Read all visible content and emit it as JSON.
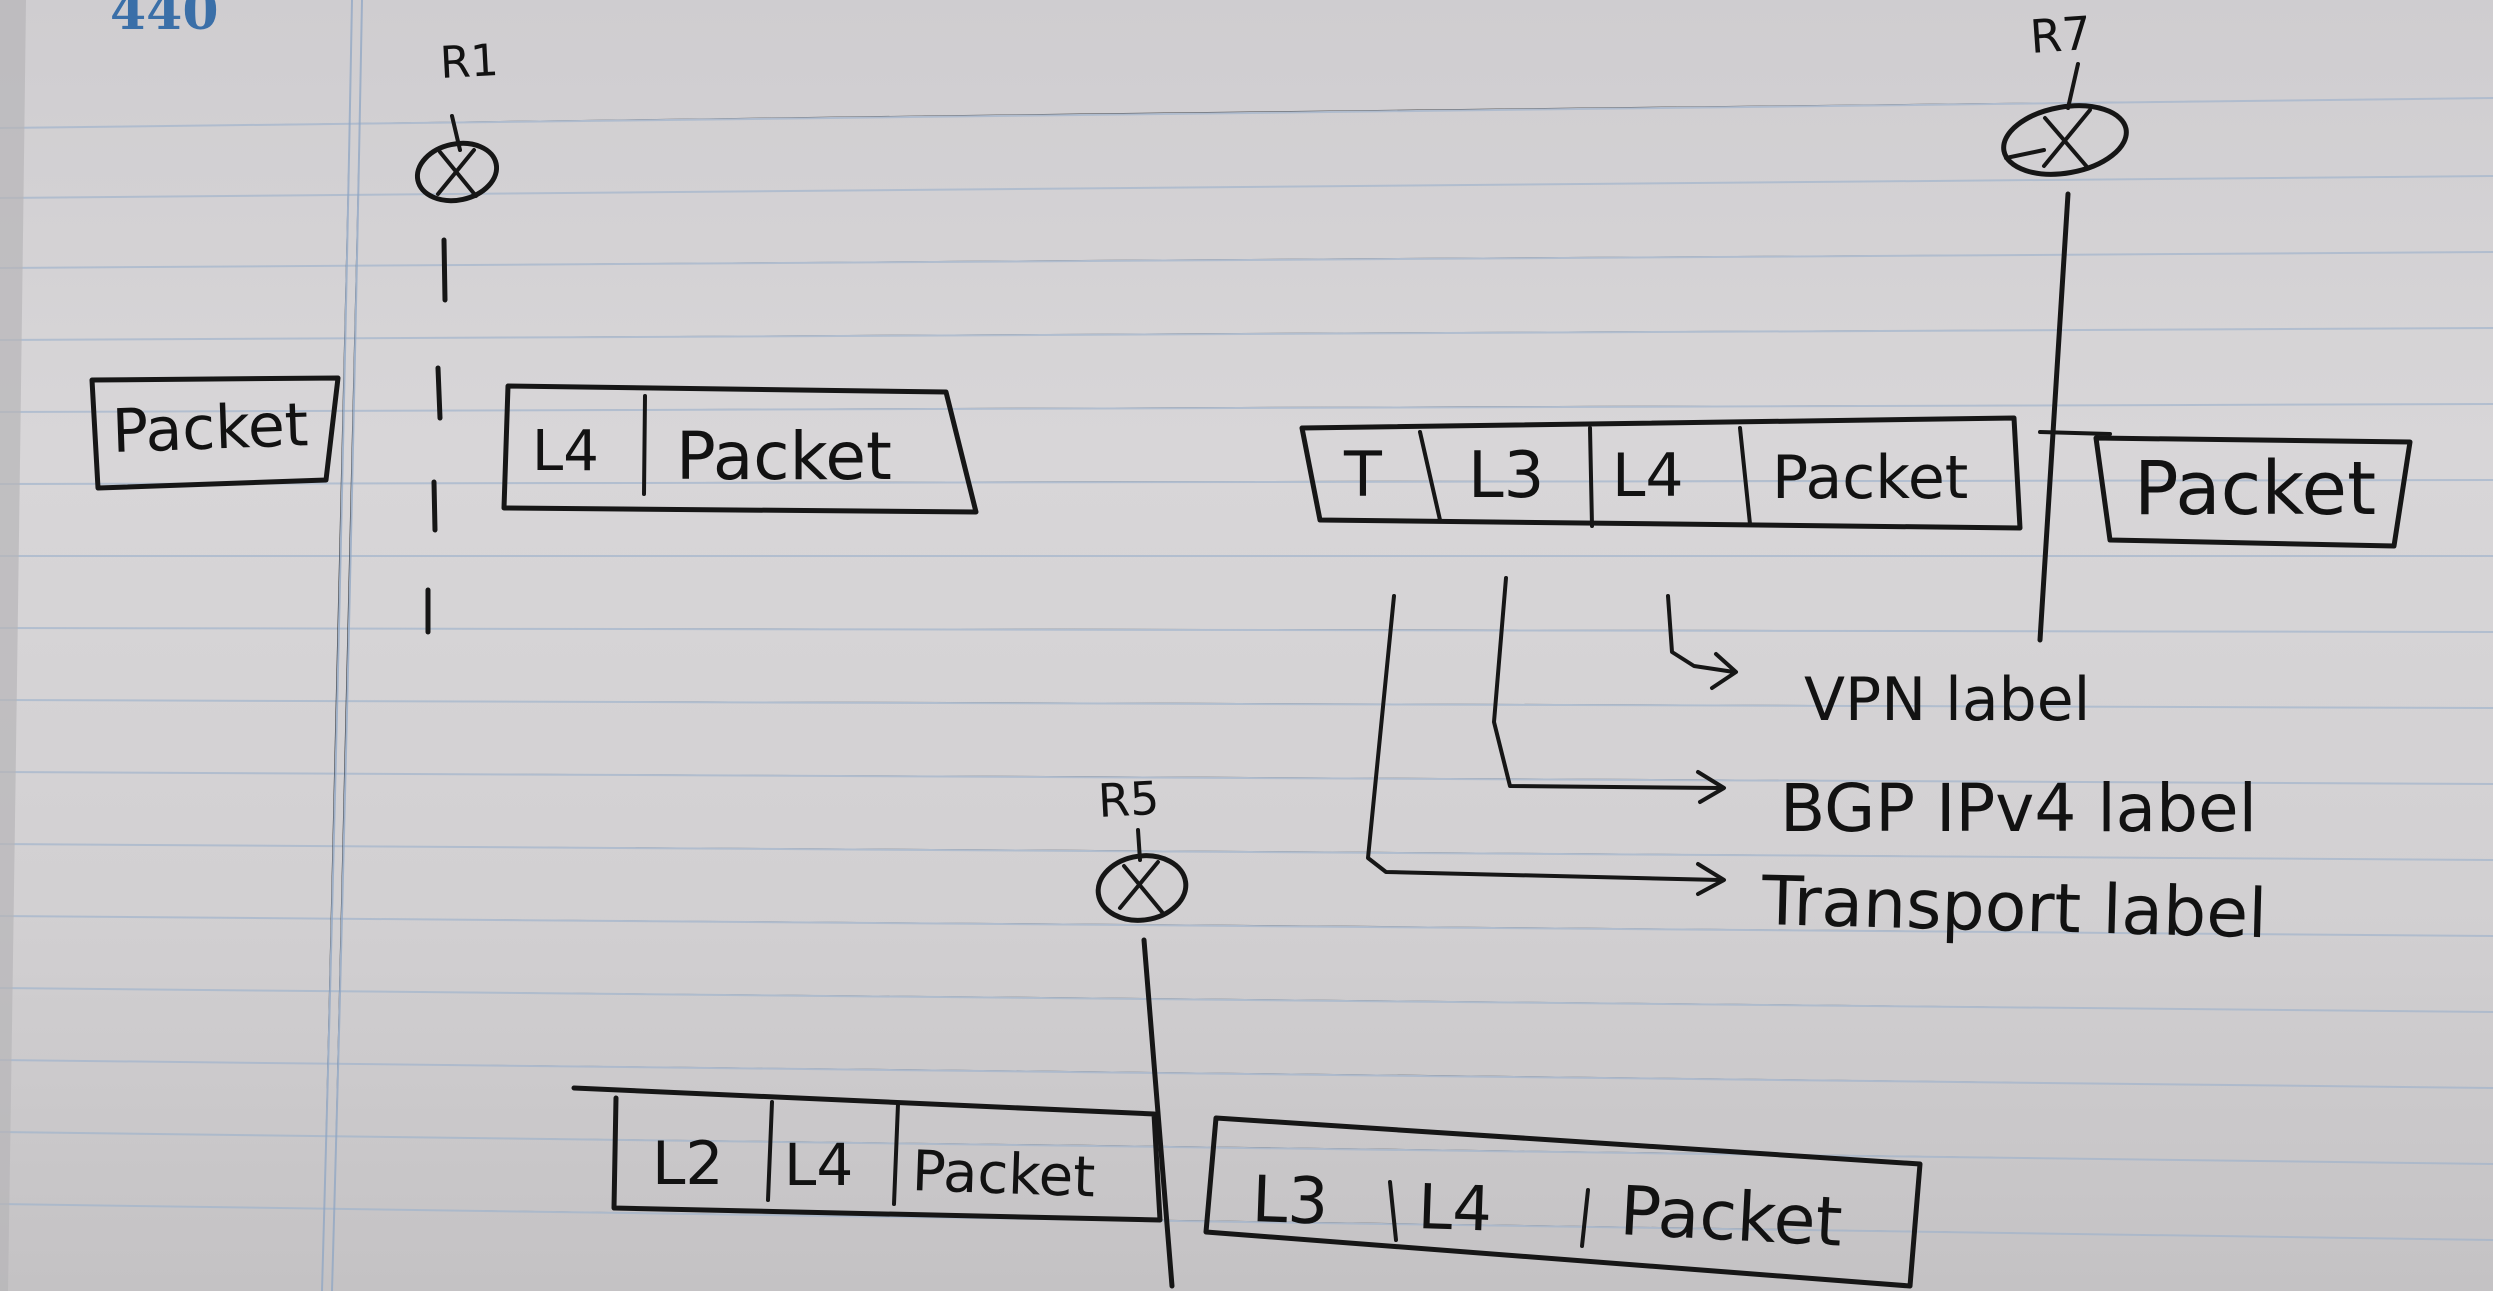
{
  "page_number": "440",
  "routers": {
    "r1": "R1",
    "r5": "R5",
    "r7": "R7"
  },
  "r1_stacks": {
    "before": [
      "Packet"
    ],
    "after": [
      "L4",
      "Packet"
    ]
  },
  "r7_stacks": {
    "before": [
      "T",
      "L3",
      "L4",
      "Packet"
    ],
    "after": [
      "Packet"
    ]
  },
  "r5_stacks": {
    "before": [
      "L2",
      "L4",
      "Packet"
    ],
    "after": [
      "L3",
      "L4",
      "Packet"
    ]
  },
  "annotations": {
    "vpn": "VPN label",
    "bgp": "BGP IPv4 label",
    "transport": "Transport label"
  },
  "colors": {
    "ink": "#161616",
    "rule_line": "#9fb3cc",
    "margin_line": "#8fa6c4",
    "page_number": "#3a6fa8"
  }
}
